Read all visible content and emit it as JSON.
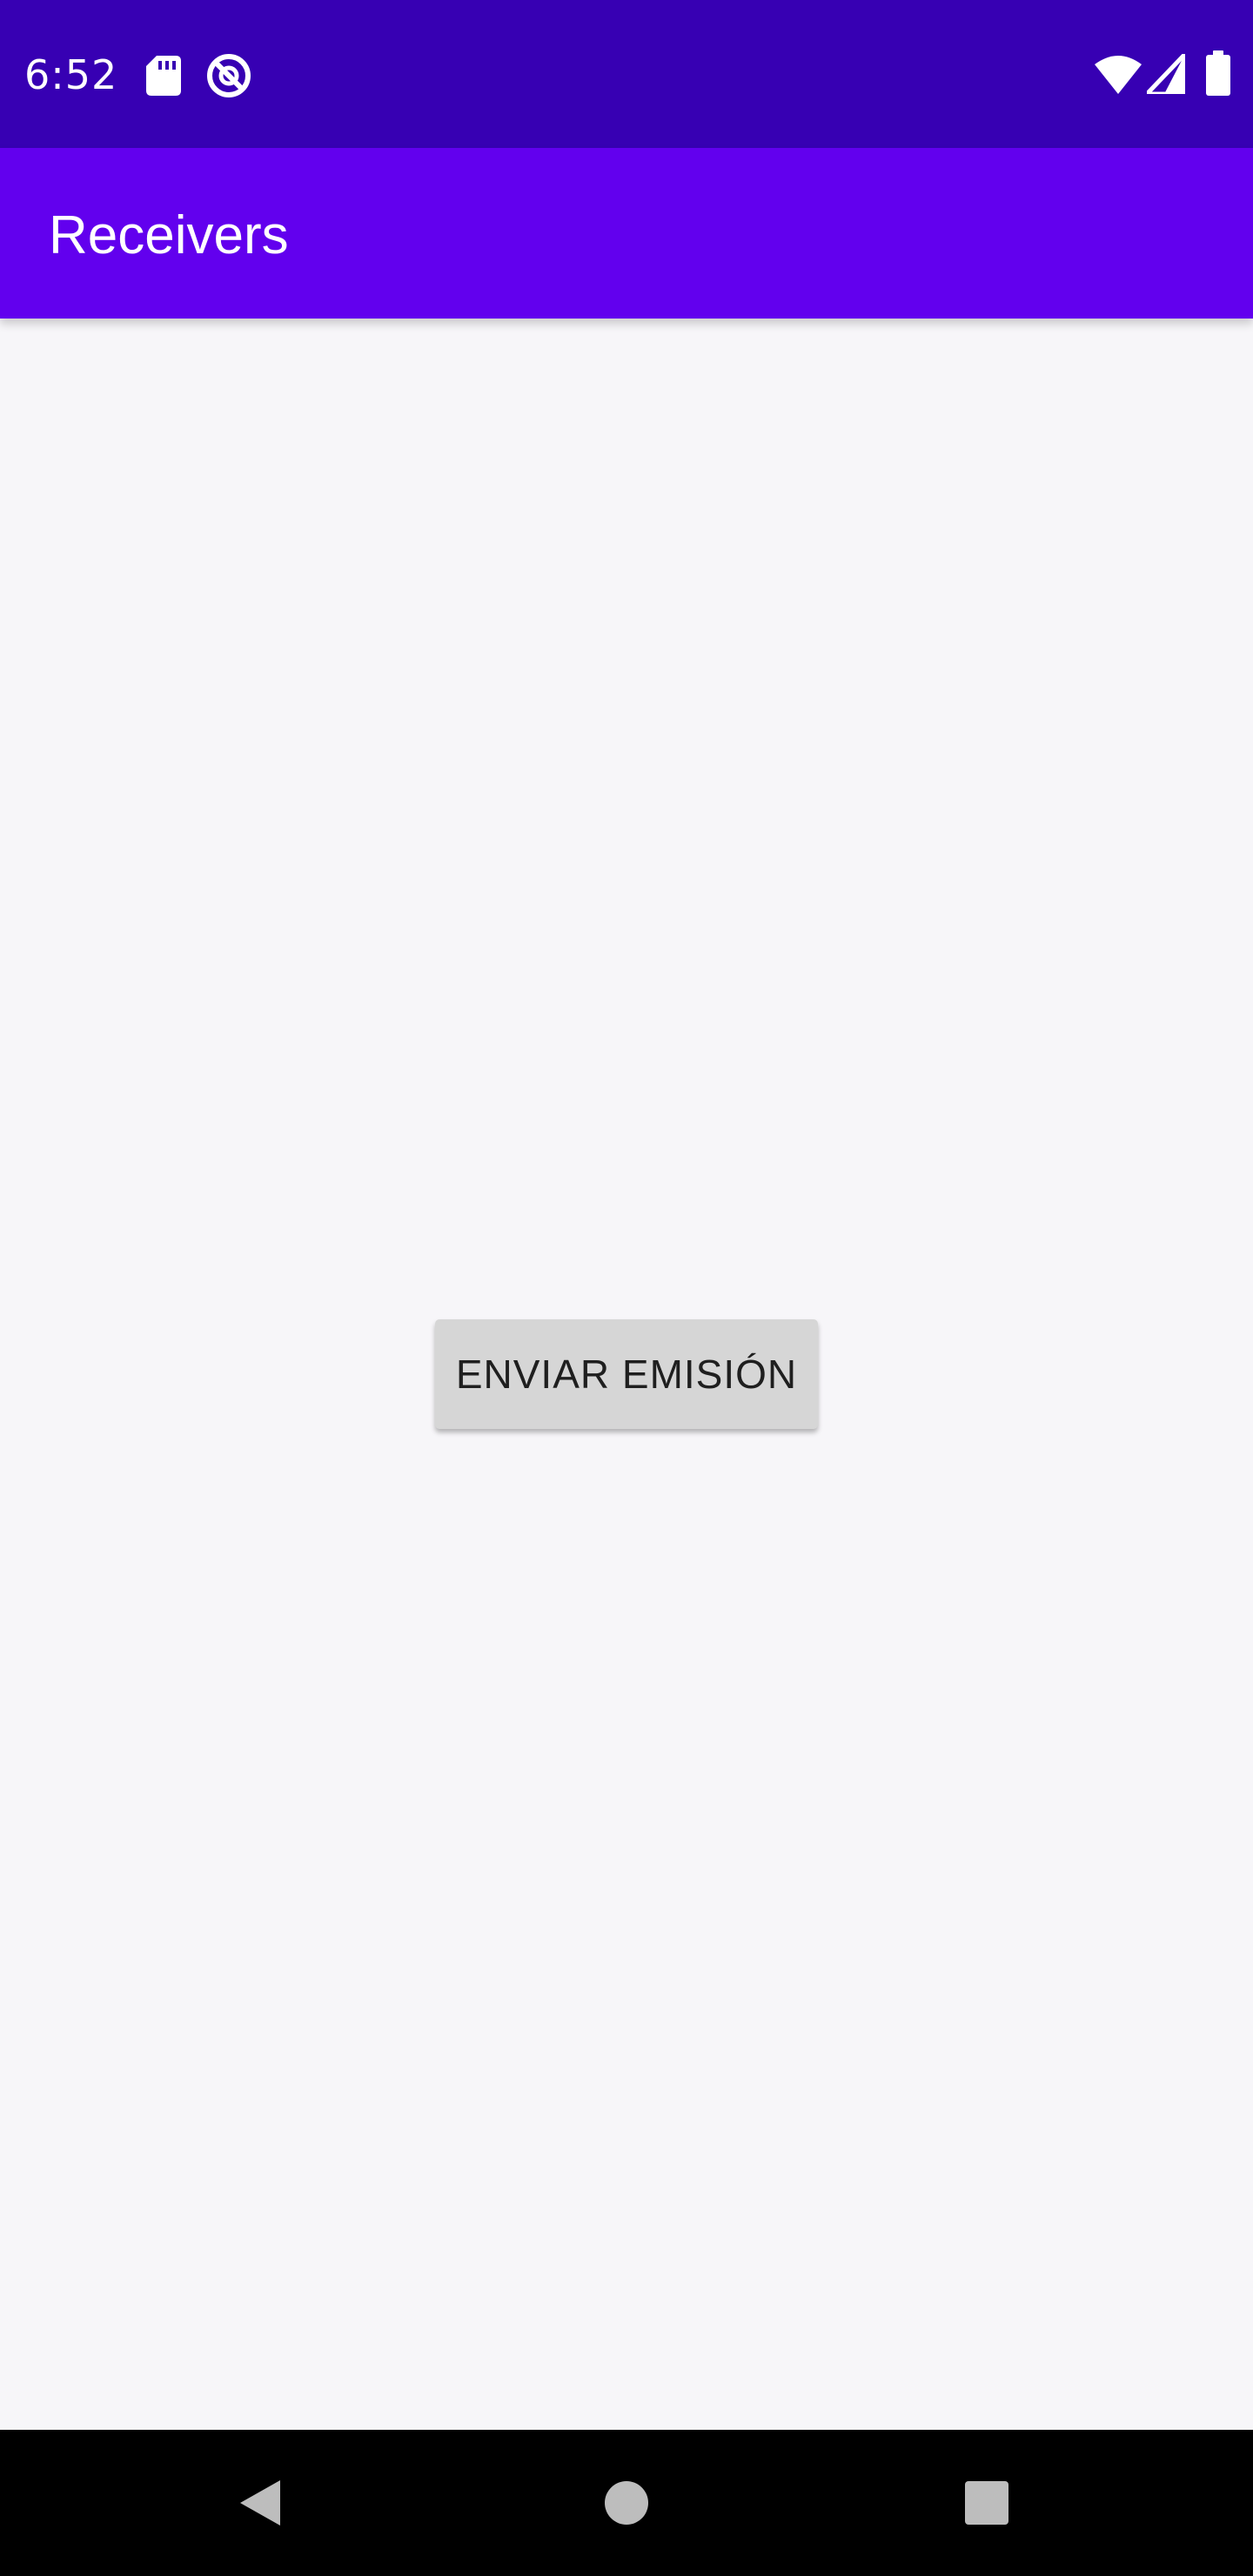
{
  "status_bar": {
    "time": "6:52",
    "icons": [
      "sd-card-icon",
      "do-not-disturb-icon",
      "wifi-icon",
      "cell-signal-icon",
      "battery-icon"
    ]
  },
  "app_bar": {
    "title": "Receivers",
    "color": "#6200ee"
  },
  "main": {
    "button_label": "ENVIAR EMISIÓN"
  },
  "nav_bar": {
    "icons": [
      "back-icon",
      "home-icon",
      "recents-icon"
    ]
  },
  "colors": {
    "status_bar": "#3700b3",
    "app_bar": "#6200ee",
    "background": "#f7f6f9",
    "button": "#d6d6d6"
  }
}
